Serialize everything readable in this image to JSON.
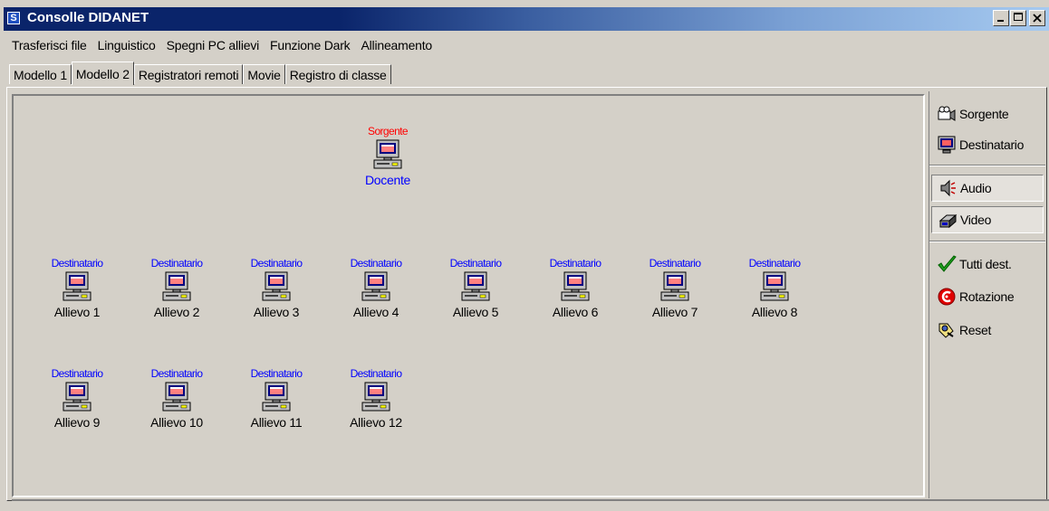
{
  "window": {
    "title": "Consolle DIDANET",
    "app_icon_letter": "S"
  },
  "menu": [
    "Trasferisci file",
    "Linguistico",
    "Spegni PC allievi",
    "Funzione Dark",
    "Allineamento"
  ],
  "tabs": [
    "Modello 1",
    "Modello 2",
    "Registratori remoti",
    "Movie",
    "Registro di classe"
  ],
  "active_tab": "Modello 2",
  "teacher": {
    "role": "Sorgente",
    "name": "Docente"
  },
  "students": [
    {
      "role": "Destinatario",
      "name": "Allievo 1"
    },
    {
      "role": "Destinatario",
      "name": "Allievo 2"
    },
    {
      "role": "Destinatario",
      "name": "Allievo 3"
    },
    {
      "role": "Destinatario",
      "name": "Allievo 4"
    },
    {
      "role": "Destinatario",
      "name": "Allievo 5"
    },
    {
      "role": "Destinatario",
      "name": "Allievo 6"
    },
    {
      "role": "Destinatario",
      "name": "Allievo 7"
    },
    {
      "role": "Destinatario",
      "name": "Allievo 8"
    },
    {
      "role": "Destinatario",
      "name": "Allievo 9"
    },
    {
      "role": "Destinatario",
      "name": "Allievo 10"
    },
    {
      "role": "Destinatario",
      "name": "Allievo 11"
    },
    {
      "role": "Destinatario",
      "name": "Allievo 12"
    }
  ],
  "toolbar": {
    "sorgente": {
      "label": "Sorgente",
      "icon": "camera-icon"
    },
    "destinatario": {
      "label": "Destinatario",
      "icon": "monitor-icon"
    },
    "audio": {
      "label": "Audio",
      "icon": "speaker-icon"
    },
    "video": {
      "label": "Video",
      "icon": "video-icon"
    },
    "tutti_dest": {
      "label": "Tutti dest.",
      "icon": "checkmark-icon"
    },
    "rotazione": {
      "label": "Rotazione",
      "icon": "rotation-icon"
    },
    "reset": {
      "label": "Reset",
      "icon": "reset-icon"
    }
  },
  "colors": {
    "source_label": "#ff0000",
    "dest_label": "#0000ff",
    "titlebar": "#0a246a",
    "face": "#d4d0c8"
  }
}
